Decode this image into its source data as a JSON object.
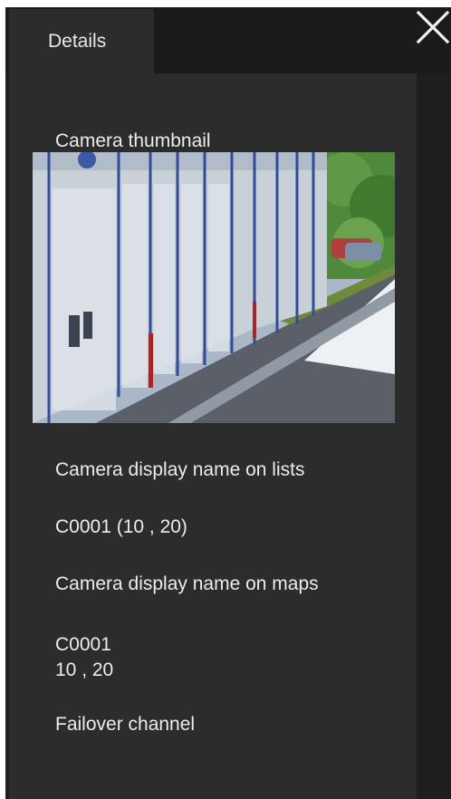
{
  "tab": {
    "label": "Details"
  },
  "close": {
    "icon": "close-icon"
  },
  "thumbnail": {
    "label": "Camera thumbnail"
  },
  "list_name": {
    "label": "Camera display name on lists",
    "value": "C0001 (10 , 20)"
  },
  "map_name": {
    "label": "Camera display name on maps",
    "value_line1": "C0001",
    "value_line2": "10 , 20"
  },
  "failover": {
    "label": "Failover channel"
  },
  "colors": {
    "panel": "#2c2c2c",
    "background": "#1f1f1f",
    "text": "#ececec"
  }
}
